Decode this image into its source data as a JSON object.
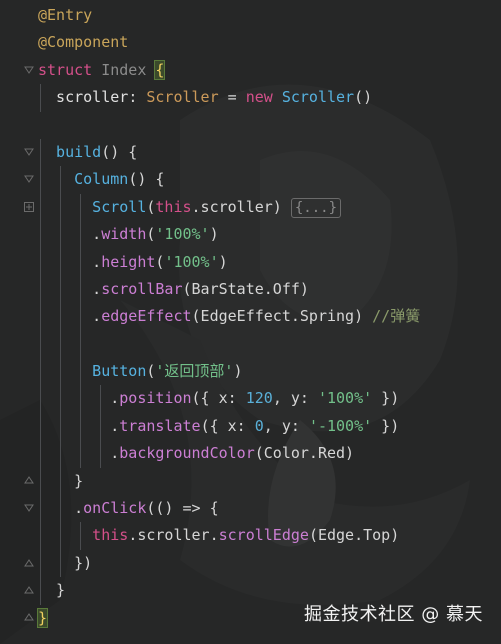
{
  "code_lines": [
    {
      "id": "l1",
      "parts": [
        [
          "ann",
          "@Entry"
        ]
      ]
    },
    {
      "id": "l2",
      "parts": [
        [
          "ann",
          "@Component"
        ]
      ]
    },
    {
      "id": "l3",
      "parts": [
        [
          "kw",
          "struct "
        ],
        [
          "grey",
          "Index "
        ],
        [
          "hl",
          "{"
        ]
      ]
    },
    {
      "id": "l4",
      "parts": [
        [
          "ty",
          "  scroller"
        ],
        [
          "pun",
          ": "
        ],
        [
          "cls",
          "Scroller"
        ],
        [
          "pun",
          " = "
        ],
        [
          "kw",
          "new "
        ],
        [
          "fn",
          "Scroller"
        ],
        [
          "pun",
          "()"
        ]
      ]
    },
    {
      "id": "l5",
      "parts": []
    },
    {
      "id": "l6",
      "parts": [
        [
          "fn",
          "  build"
        ],
        [
          "pun",
          "() {"
        ]
      ]
    },
    {
      "id": "l7",
      "parts": [
        [
          "fn",
          "    Column"
        ],
        [
          "pun",
          "() {"
        ]
      ]
    },
    {
      "id": "l8",
      "parts": [
        [
          "fn",
          "      Scroll"
        ],
        [
          "pun",
          "("
        ],
        [
          "kw",
          "this"
        ],
        [
          "pun",
          ".scroller) "
        ],
        [
          "fold",
          "{...}"
        ]
      ]
    },
    {
      "id": "l9",
      "parts": [
        [
          "pun",
          "      ."
        ],
        [
          "prop",
          "width"
        ],
        [
          "pun",
          "("
        ],
        [
          "str",
          "'100%'"
        ],
        [
          "pun",
          ")"
        ]
      ]
    },
    {
      "id": "l10",
      "parts": [
        [
          "pun",
          "      ."
        ],
        [
          "prop",
          "height"
        ],
        [
          "pun",
          "("
        ],
        [
          "str",
          "'100%'"
        ],
        [
          "pun",
          ")"
        ]
      ]
    },
    {
      "id": "l11",
      "parts": [
        [
          "pun",
          "      ."
        ],
        [
          "prop",
          "scrollBar"
        ],
        [
          "pun",
          "(BarState.Off)"
        ]
      ]
    },
    {
      "id": "l12",
      "parts": [
        [
          "pun",
          "      ."
        ],
        [
          "prop",
          "edgeEffect"
        ],
        [
          "pun",
          "(EdgeEffect.Spring) "
        ],
        [
          "cmt",
          "//弹簧"
        ]
      ]
    },
    {
      "id": "l13",
      "parts": []
    },
    {
      "id": "l14",
      "parts": [
        [
          "fn",
          "      Button"
        ],
        [
          "pun",
          "("
        ],
        [
          "str",
          "'返回顶部'"
        ],
        [
          "pun",
          ")"
        ]
      ]
    },
    {
      "id": "l15",
      "parts": [
        [
          "pun",
          "        ."
        ],
        [
          "prop",
          "position"
        ],
        [
          "pun",
          "({ x: "
        ],
        [
          "num",
          "120"
        ],
        [
          "pun",
          ", y: "
        ],
        [
          "str",
          "'100%'"
        ],
        [
          "pun",
          " })"
        ]
      ]
    },
    {
      "id": "l16",
      "parts": [
        [
          "pun",
          "        ."
        ],
        [
          "prop",
          "translate"
        ],
        [
          "pun",
          "({ x: "
        ],
        [
          "num",
          "0"
        ],
        [
          "pun",
          ", y: "
        ],
        [
          "str",
          "'-100%'"
        ],
        [
          "pun",
          " })"
        ]
      ]
    },
    {
      "id": "l17",
      "parts": [
        [
          "pun",
          "        ."
        ],
        [
          "prop",
          "backgroundColor"
        ],
        [
          "pun",
          "(Color.Red)"
        ]
      ]
    },
    {
      "id": "l18",
      "parts": [
        [
          "pun",
          "    }"
        ]
      ]
    },
    {
      "id": "l19",
      "parts": [
        [
          "pun",
          "    ."
        ],
        [
          "prop",
          "onClick"
        ],
        [
          "pun",
          "(() => {"
        ]
      ]
    },
    {
      "id": "l20",
      "parts": [
        [
          "kw",
          "      this"
        ],
        [
          "pun",
          ".scroller."
        ],
        [
          "prop",
          "scrollEdge"
        ],
        [
          "pun",
          "(Edge.Top)"
        ]
      ]
    },
    {
      "id": "l21",
      "parts": [
        [
          "pun",
          "    })"
        ]
      ]
    },
    {
      "id": "l22",
      "parts": [
        [
          "pun",
          "  }"
        ]
      ]
    },
    {
      "id": "l23",
      "parts": [
        [
          "hl",
          "}"
        ]
      ]
    }
  ],
  "watermark": "掘金技术社区 @ 慕天",
  "colors": {
    "background": "#252626",
    "keyword": "#d4508a",
    "annotation": "#c9a55a",
    "function": "#56b2e0",
    "property": "#cc7fd4",
    "string": "#72c08a"
  }
}
